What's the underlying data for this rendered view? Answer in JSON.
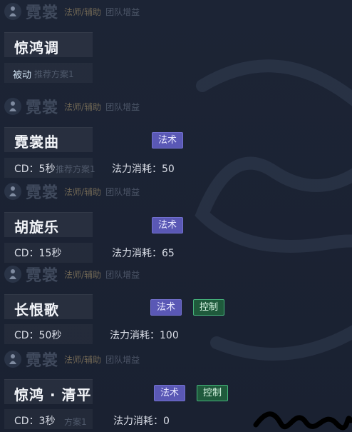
{
  "hero": {
    "name": "霓裳",
    "role": "法师/辅助",
    "tags": "团队增益"
  },
  "skills": [
    {
      "title": "惊鸿调",
      "passive_label": "被动",
      "ghost": "推荐方案1"
    },
    {
      "title": "霓裳曲",
      "tag1": "法术",
      "cd": "CD：5秒",
      "cost": "法力消耗：50",
      "ghost": "推荐方案1"
    },
    {
      "title": "胡旋乐",
      "tag1": "法术",
      "cd": "CD：15秒",
      "cost": "法力消耗：65"
    },
    {
      "title": "长恨歌",
      "tag1": "法术",
      "tag2": "控制",
      "cd": "CD：50秒",
      "cost": "法力消耗：100"
    },
    {
      "title": "惊鸿 · 清平",
      "tag1": "法术",
      "tag2": "控制",
      "cd": "CD：3秒",
      "cost": "法力消耗：0",
      "ghost": "方案1"
    }
  ],
  "colors": {
    "background": "#1a2232",
    "magic_tag": "#5a58b5",
    "control_tag": "#1f5a3c",
    "control_border": "#46b57c"
  },
  "icons": {
    "hero_icon": "hero-portrait-icon",
    "decoration": "mountain-decoration-icon"
  }
}
